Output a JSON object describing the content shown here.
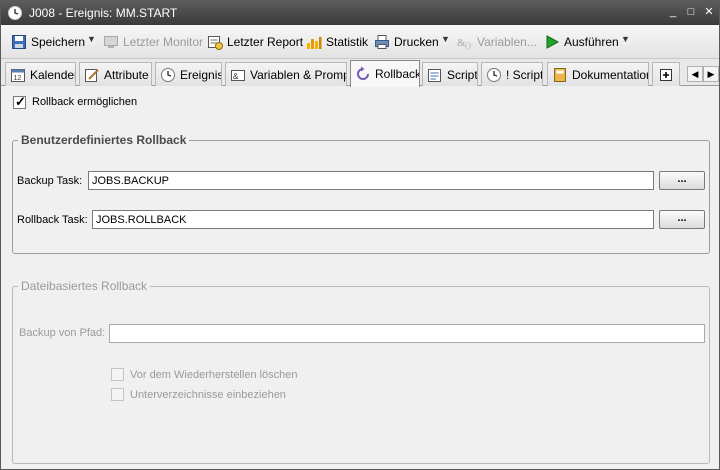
{
  "window": {
    "title": "J008 - Ereignis: MM.START",
    "minimize": "_",
    "maximize": "□",
    "close": "✕"
  },
  "toolbar": {
    "save": "Speichern",
    "last_monitor": "Letzter Monitor",
    "last_report": "Letzter Report",
    "statistics": "Statistik",
    "print": "Drucken",
    "variables": "Variablen...",
    "execute": "Ausführen"
  },
  "tabs": [
    {
      "label": "Kalender",
      "icon": "calendar-icon"
    },
    {
      "label": "Attribute",
      "icon": "attributes-icon"
    },
    {
      "label": "Ereignis",
      "icon": "clock-icon"
    },
    {
      "label": "Variablen & Prompts",
      "icon": "variables-icon"
    },
    {
      "label": "Rollback",
      "icon": "rollback-icon",
      "active": true
    },
    {
      "label": "Script",
      "icon": "script-icon"
    },
    {
      "label": "! Script",
      "icon": "clock-icon"
    },
    {
      "label": "Dokumentation",
      "icon": "book-icon"
    }
  ],
  "rollback": {
    "enable_label": "Rollback ermöglichen",
    "enable_checked": true,
    "custom_group_title": "Benutzerdefiniertes Rollback",
    "backup_task_label": "Backup Task:",
    "backup_task_value": "JOBS.BACKUP",
    "rollback_task_label": "Rollback Task:",
    "rollback_task_value": "JOBS.ROLLBACK",
    "browse_label": "...",
    "file_group_title": "Dateibasiertes Rollback",
    "backup_path_label": "Backup von Pfad:",
    "backup_path_value": "",
    "delete_before_restore_label": "Vor dem Wiederherstellen löschen",
    "include_subdirs_label": "Unterverzeichnisse einbeziehen"
  }
}
